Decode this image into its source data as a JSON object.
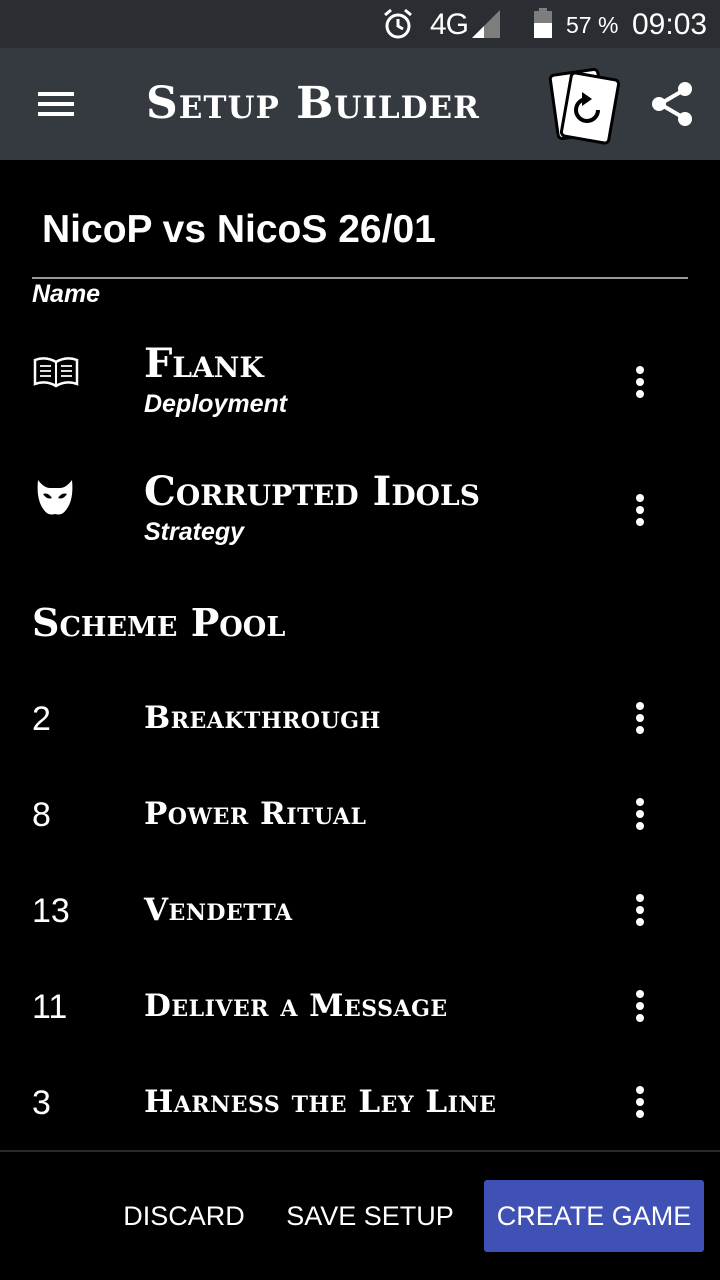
{
  "status": {
    "network": "4G",
    "battery": "57 %",
    "time": "09:03"
  },
  "app_bar": {
    "title": "Setup Builder"
  },
  "setup": {
    "name": "NicoP vs NicoS 26/01",
    "name_label": "Name"
  },
  "deployment": {
    "title": "Flank",
    "subtitle": "Deployment"
  },
  "strategy": {
    "title": "Corrupted Idols",
    "subtitle": "Strategy"
  },
  "scheme_pool": {
    "heading": "Scheme Pool",
    "items": [
      {
        "number": "2",
        "name": "Breakthrough"
      },
      {
        "number": "8",
        "name": "Power Ritual"
      },
      {
        "number": "13",
        "name": "Vendetta"
      },
      {
        "number": "11",
        "name": "Deliver a Message"
      },
      {
        "number": "3",
        "name": "Harness the Ley Line"
      }
    ]
  },
  "actions": {
    "discard": "DISCARD",
    "save": "SAVE SETUP",
    "create": "CREATE GAME"
  },
  "colors": {
    "status_bar": "#2a2d31",
    "app_bar": "#343a40",
    "accent": "#3f51b5",
    "background": "#000000"
  }
}
